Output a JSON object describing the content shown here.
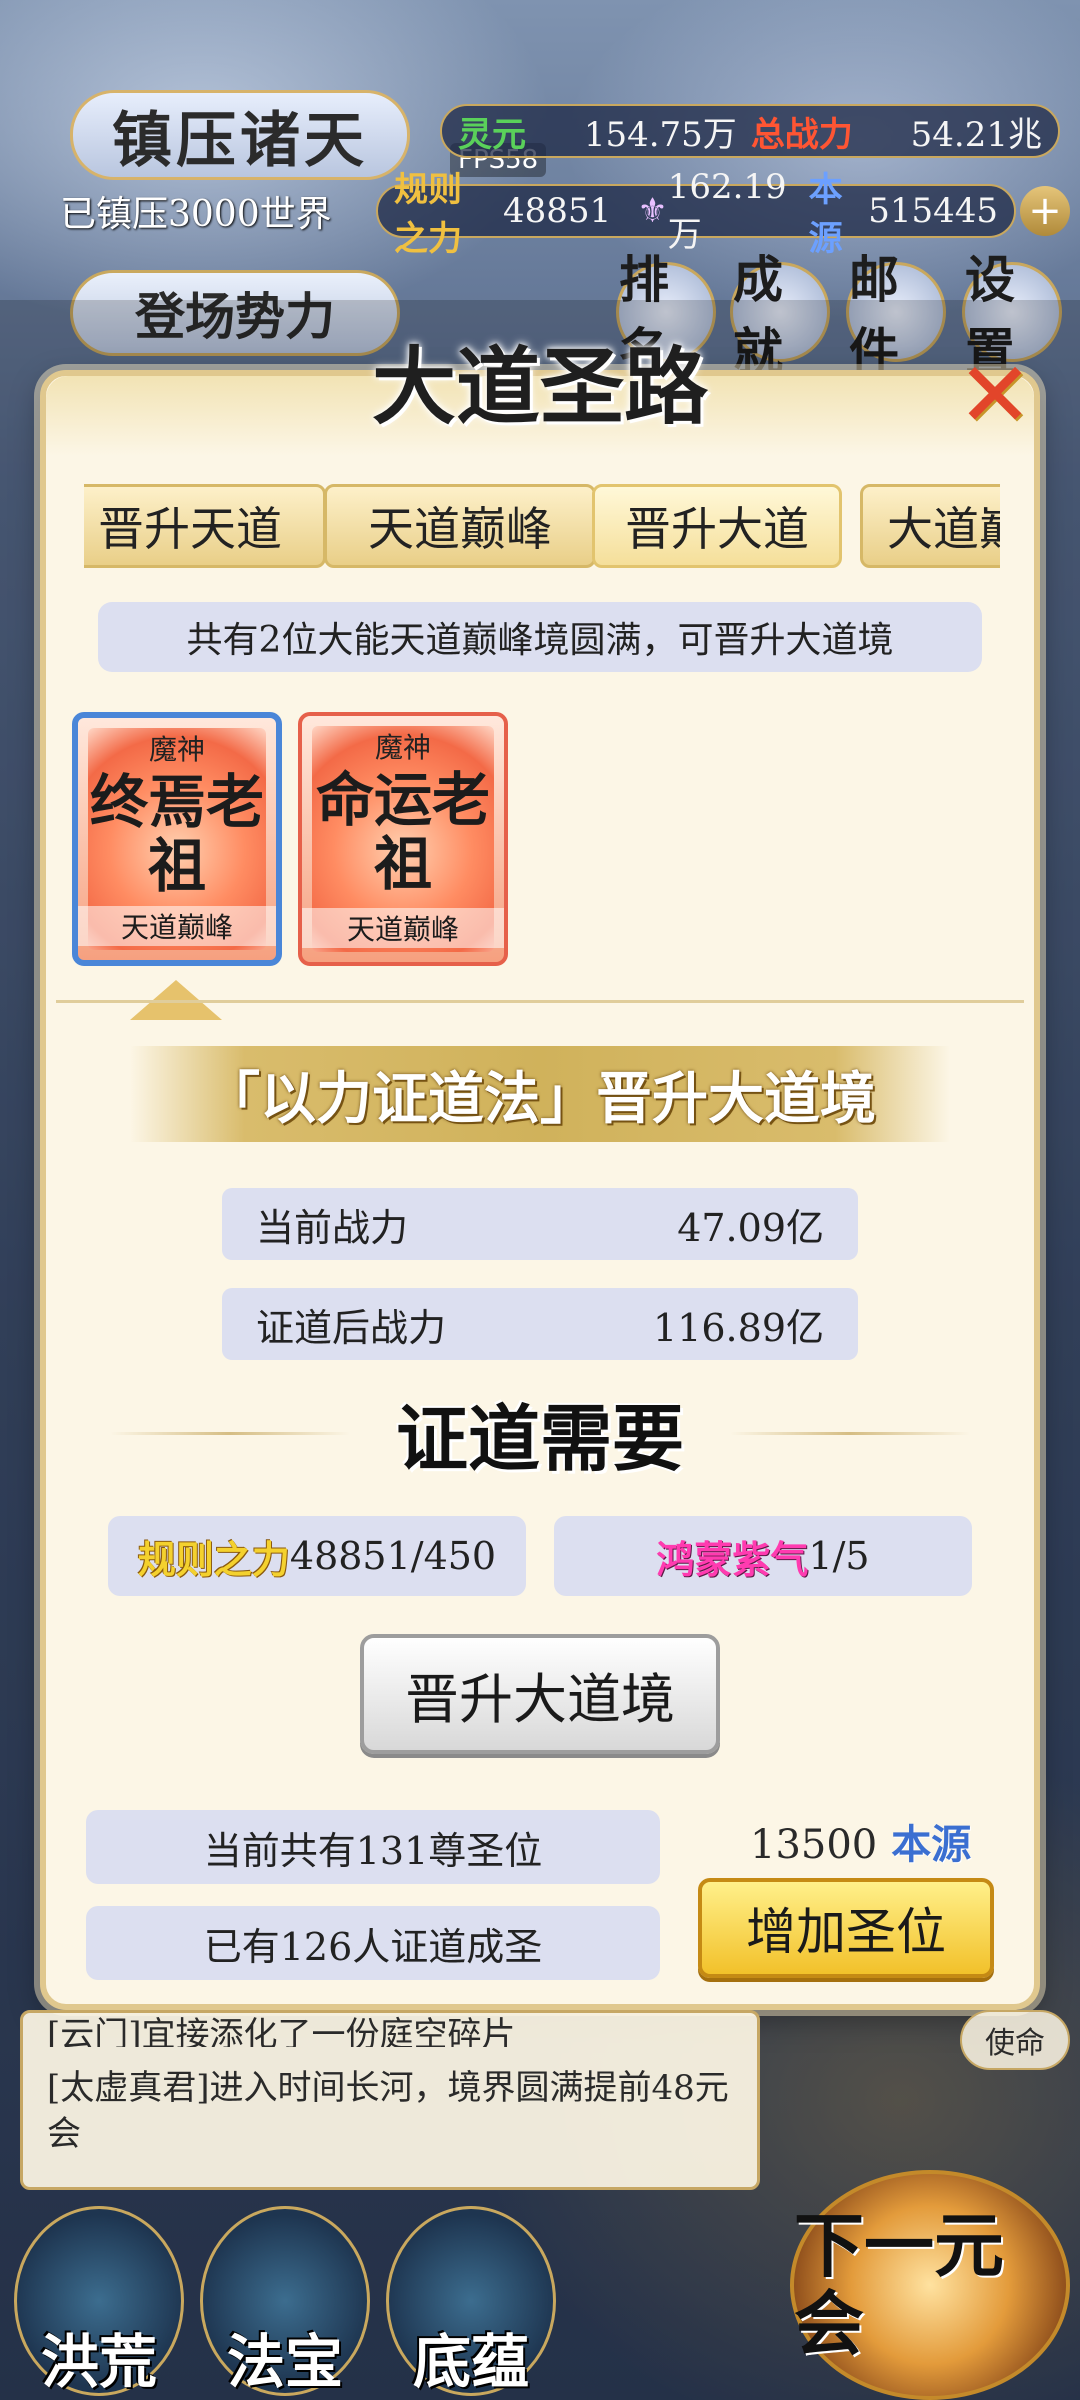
{
  "header": {
    "game_title": "镇压诸天",
    "suppressed_worlds": "已镇压3000世界",
    "fps": "FPS58",
    "stats": {
      "lingyuan_label": "灵元",
      "lingyuan_value": "154.75万",
      "power_label": "总战力",
      "power_value": "54.21兆",
      "rule_label": "规则之力",
      "rule_value": "48851",
      "item_value": "162.19万",
      "source_label": "本源",
      "source_value": "515445"
    },
    "faction_button": "登场势力",
    "nav": {
      "rank": "排名",
      "achieve": "成就",
      "mail": "邮件",
      "settings": "设置"
    }
  },
  "modal": {
    "title": "大道圣路",
    "tabs": [
      "晋升天道",
      "天道巅峰",
      "晋升大道",
      "大道巅峰"
    ],
    "active_tab_index": 2,
    "notice": "共有2位大能天道巅峰境圆满，可晋升大道境",
    "candidates": [
      {
        "race": "魔神",
        "name": "终焉老祖",
        "realm": "天道巅峰",
        "selected": true
      },
      {
        "race": "魔神",
        "name": "命运老祖",
        "realm": "天道巅峰",
        "selected": false
      }
    ],
    "method": "「以力证道法」晋升大道境",
    "current_power_label": "当前战力",
    "current_power_value": "47.09亿",
    "after_power_label": "证道后战力",
    "after_power_value": "116.89亿",
    "requirements_title": "证道需要",
    "req_rule_label": "规则之力",
    "req_rule_value": "48851/450",
    "req_qi_label": "鸿蒙紫气",
    "req_qi_value": "1/5",
    "ascend_button": "晋升大道境",
    "saint_seats": "当前共有131尊圣位",
    "saints_done": "已有126人证道成圣",
    "add_cost_value": "13500",
    "add_cost_currency": "本源",
    "add_button": "增加圣位"
  },
  "log": {
    "line1": "[云门]宜接添化了一份庭空碎片",
    "line2": "[太虚真君]进入时间长河，境界圆满提前48元会"
  },
  "side_mission": "使命",
  "bottom_nav": [
    "洪荒",
    "法宝",
    "底蕴"
  ],
  "next_era": "下一元会",
  "colors": {
    "accent_gold": "#d9bc6c",
    "close_red": "#e2452a",
    "panel_bg": "#fcf6e6"
  },
  "icons": [
    "close-icon",
    "plus-icon"
  ]
}
